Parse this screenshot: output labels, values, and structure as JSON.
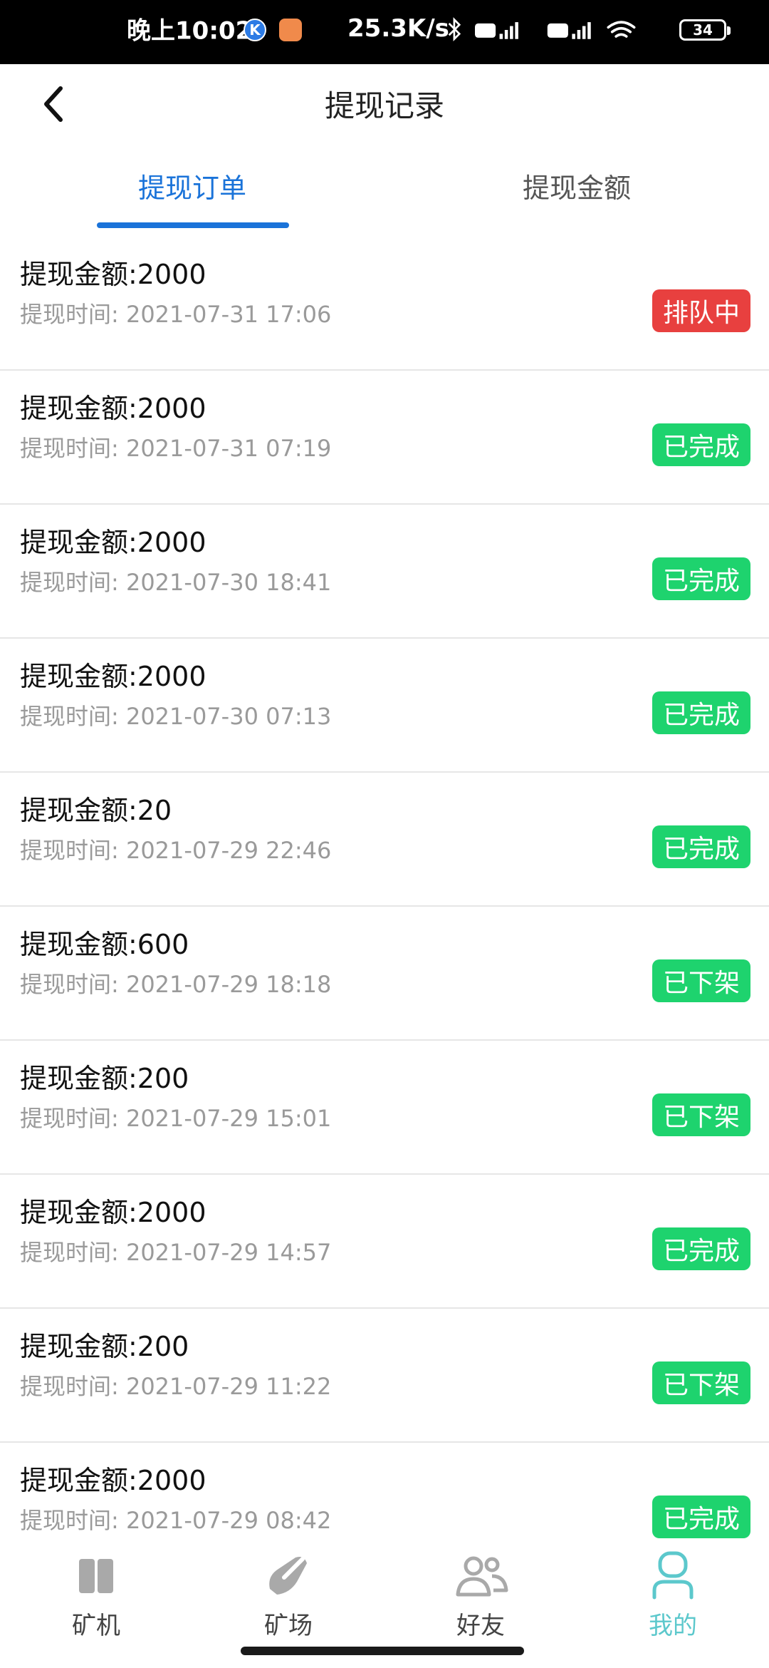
{
  "status_bar": {
    "time": "晚上10:02",
    "app_badge_letter": "K",
    "network_speed": "25.3K/s",
    "battery": "34"
  },
  "header": {
    "title": "提现记录",
    "back_icon": "chevron-left-icon"
  },
  "tabs": [
    {
      "label": "提现订单",
      "active": true
    },
    {
      "label": "提现金额",
      "active": false
    }
  ],
  "colors": {
    "accent": "#1a73d9",
    "queued": "#e8403f",
    "done": "#1ed36e",
    "nav_active": "#5cc8cc"
  },
  "records": [
    {
      "amount": "提现金额:2000",
      "time": "提现时间: 2021-07-31 17:06",
      "status": "排队中",
      "status_color": "#e8403f"
    },
    {
      "amount": "提现金额:2000",
      "time": "提现时间: 2021-07-31 07:19",
      "status": "已完成",
      "status_color": "#1ed36e"
    },
    {
      "amount": "提现金额:2000",
      "time": "提现时间: 2021-07-30 18:41",
      "status": "已完成",
      "status_color": "#1ed36e"
    },
    {
      "amount": "提现金额:2000",
      "time": "提现时间: 2021-07-30 07:13",
      "status": "已完成",
      "status_color": "#1ed36e"
    },
    {
      "amount": "提现金额:20",
      "time": "提现时间: 2021-07-29 22:46",
      "status": "已完成",
      "status_color": "#1ed36e"
    },
    {
      "amount": "提现金额:600",
      "time": "提现时间: 2021-07-29 18:18",
      "status": "已下架",
      "status_color": "#1ed36e"
    },
    {
      "amount": "提现金额:200",
      "time": "提现时间: 2021-07-29 15:01",
      "status": "已下架",
      "status_color": "#1ed36e"
    },
    {
      "amount": "提现金额:2000",
      "time": "提现时间: 2021-07-29 14:57",
      "status": "已完成",
      "status_color": "#1ed36e"
    },
    {
      "amount": "提现金额:200",
      "time": "提现时间: 2021-07-29 11:22",
      "status": "已下架",
      "status_color": "#1ed36e"
    },
    {
      "amount": "提现金额:2000",
      "time": "提现时间: 2021-07-29 08:42",
      "status": "已完成",
      "status_color": "#1ed36e"
    }
  ],
  "bottom_nav": [
    {
      "label": "矿机",
      "icon": "miner-icon",
      "active": false
    },
    {
      "label": "矿场",
      "icon": "pickaxe-icon",
      "active": false
    },
    {
      "label": "好友",
      "icon": "friends-icon",
      "active": false
    },
    {
      "label": "我的",
      "icon": "profile-icon",
      "active": true
    }
  ]
}
